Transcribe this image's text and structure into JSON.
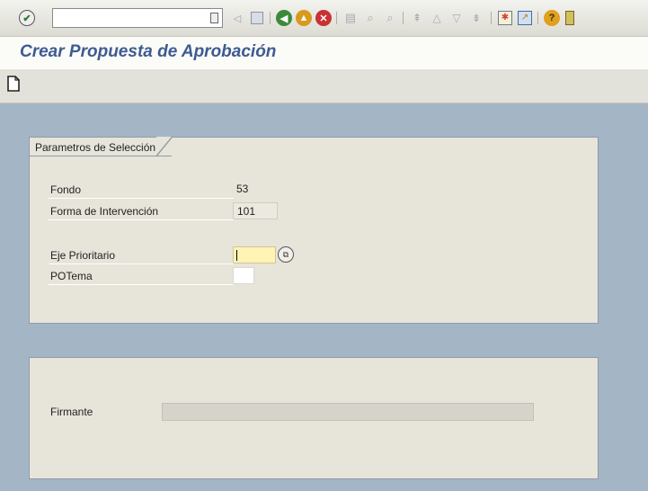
{
  "toolbar": {
    "command_field": {
      "value": ""
    },
    "icons": [
      "enter-icon",
      "back-icon",
      "exit-icon",
      "cancel-icon",
      "print-icon",
      "find-icon",
      "find-next-icon",
      "first-page-icon",
      "previous-page-icon",
      "next-page-icon",
      "last-page-icon",
      "create-session-icon",
      "shortcut-icon",
      "help-icon",
      "layout-icon"
    ]
  },
  "title": "Crear Propuesta de Aprobación",
  "selection_group": {
    "title": "Parametros de Selección",
    "fields": [
      {
        "label": "Fondo",
        "value": "53"
      },
      {
        "label": "Forma de Intervención",
        "value": "101"
      },
      {
        "label": "Eje Prioritario",
        "value": ""
      },
      {
        "label": "POTema",
        "value": ""
      }
    ]
  },
  "signer_group": {
    "label": "Firmante",
    "value": ""
  },
  "colors": {
    "title": "#3d5b92",
    "workarea": "#a4b6c6",
    "group_bg": "#e7e4da",
    "focus_field": "#fff4b3"
  }
}
